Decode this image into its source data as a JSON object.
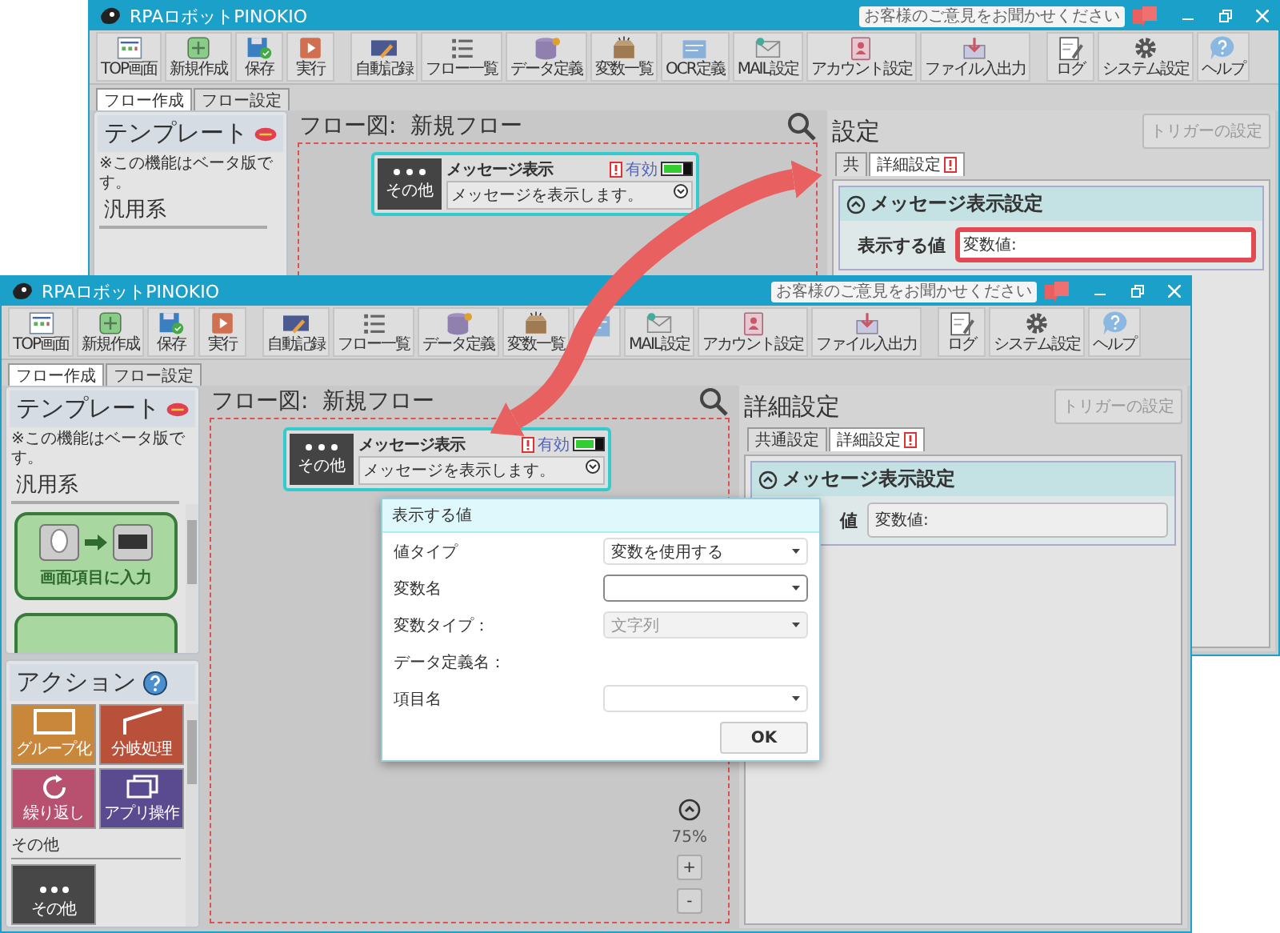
{
  "windows": [
    {
      "title": "RPAロボットPINOKIO",
      "feedback": "お客様のご意見をお聞かせください",
      "toolbar": [
        [
          {
            "kind": "top",
            "label": "TOP画面"
          },
          {
            "kind": "new",
            "label": "新規作成"
          },
          {
            "kind": "save",
            "label": "保存"
          },
          {
            "kind": "run",
            "label": "実行"
          }
        ],
        [
          {
            "kind": "record",
            "label": "自動記録"
          },
          {
            "kind": "list",
            "label": "フロー一覧"
          },
          {
            "kind": "data",
            "label": "データ定義"
          },
          {
            "kind": "variables",
            "label": "変数一覧"
          },
          {
            "kind": "ocr",
            "label": "OCR定義"
          },
          {
            "kind": "mail",
            "label": "MAIL設定"
          },
          {
            "kind": "account",
            "label": "アカウント設定"
          },
          {
            "kind": "file",
            "label": "ファイル入出力"
          }
        ],
        [
          {
            "kind": "log",
            "label": "ログ"
          },
          {
            "kind": "system",
            "label": "システム設定"
          },
          {
            "kind": "help",
            "label": "ヘルプ"
          }
        ]
      ],
      "tabs": [
        {
          "label": "フロー作成",
          "selected": true
        },
        {
          "label": "フロー設定",
          "selected": false
        }
      ],
      "template_panel": {
        "title": "テンプレート",
        "note": "※この機能はベータ版です。",
        "category": "汎用系"
      },
      "flow": {
        "title": "フロー図:  新規フロー",
        "node": {
          "icon_label": "その他",
          "title": "メッセージ表示",
          "warning": true,
          "status": "有効",
          "enabled": true,
          "description": "メッセージを表示します。"
        }
      },
      "settings": {
        "title": "設定",
        "trigger_button": {
          "label": "トリガーの設定",
          "disabled": true
        },
        "tabs": [
          {
            "label": "共",
            "selected": false,
            "warning": false
          },
          {
            "label": "詳細設定",
            "selected": true,
            "warning": true
          }
        ],
        "section": {
          "title": "メッセージ表示設定",
          "expanded": true
        },
        "row": {
          "label": "表示する値",
          "value": "変数値:",
          "highlighted": true
        }
      }
    },
    {
      "title": "RPAロボットPINOKIO",
      "feedback": "お客様のご意見をお聞かせください",
      "toolbar": [
        [
          {
            "kind": "top",
            "label": "TOP画面"
          },
          {
            "kind": "new",
            "label": "新規作成"
          },
          {
            "kind": "save",
            "label": "保存"
          },
          {
            "kind": "run",
            "label": "実行"
          }
        ],
        [
          {
            "kind": "record",
            "label": "自動記録"
          },
          {
            "kind": "list",
            "label": "フロー一覧"
          },
          {
            "kind": "data",
            "label": "データ定義"
          },
          {
            "kind": "variables",
            "label": "変数一覧"
          },
          {
            "kind": "ocr"
          },
          {
            "kind": "mail",
            "label": "MAIL設定"
          },
          {
            "kind": "account",
            "label": "アカウント設定"
          },
          {
            "kind": "file",
            "label": "ファイル入出力"
          }
        ],
        [
          {
            "kind": "log",
            "label": "ログ"
          },
          {
            "kind": "system",
            "label": "システム設定"
          },
          {
            "kind": "help",
            "label": "ヘルプ"
          }
        ]
      ],
      "tabs": [
        {
          "label": "フロー作成",
          "selected": true
        },
        {
          "label": "フロー設定",
          "selected": false
        }
      ],
      "template_panel": {
        "title": "テンプレート",
        "note": "※この機能はベータ版です。",
        "category": "汎用系",
        "cards": [
          {
            "label": "画面項目に入力"
          }
        ]
      },
      "action_panel": {
        "title": "アクション",
        "tiles": [
          {
            "kind": "group",
            "label": "グループ化",
            "color": "#c8873a"
          },
          {
            "kind": "branch",
            "label": "分岐処理",
            "color": "#b8503a"
          },
          {
            "kind": "loop",
            "label": "繰り返し",
            "color": "#b85070"
          },
          {
            "kind": "app",
            "label": "アプリ操作",
            "color": "#5a4a90"
          }
        ],
        "other_heading": "その他",
        "other_tiles": [
          {
            "kind": "other",
            "label": "その他",
            "color": "#474747"
          }
        ]
      },
      "flow": {
        "title": "フロー図:  新規フロー",
        "node": {
          "icon_label": "その他",
          "title": "メッセージ表示",
          "warning": true,
          "status": "有効",
          "enabled": true,
          "description": "メッセージを表示します。"
        },
        "zoom": "75%",
        "zoom_buttons": [
          "+",
          "-"
        ]
      },
      "settings": {
        "title": "詳細設定",
        "trigger_button": {
          "label": "トリガーの設定",
          "disabled": true
        },
        "tabs": [
          {
            "label": "共通設定",
            "selected": false,
            "warning": false
          },
          {
            "label": "詳細設定",
            "selected": true,
            "warning": true
          }
        ],
        "section": {
          "title": "メッセージ表示設定",
          "expanded": true
        },
        "row": {
          "label": "値",
          "value": "変数値:",
          "highlighted": false
        }
      },
      "dialog": {
        "title": "表示する値",
        "rows": [
          {
            "label": "値タイプ",
            "kind": "dropdown",
            "value": "変数を使用する",
            "focused": false,
            "disabled": false
          },
          {
            "label": "変数名",
            "kind": "dropdown",
            "focused": true,
            "disabled": false
          },
          {
            "label": "変数タイプ：",
            "kind": "dropdown",
            "value": "文字列",
            "focused": false,
            "disabled": true
          },
          {
            "label": "データ定義名：",
            "kind": "none"
          },
          {
            "label": "項目名",
            "kind": "dropdown",
            "focused": false,
            "disabled": false
          }
        ],
        "button": "OK"
      }
    }
  ]
}
